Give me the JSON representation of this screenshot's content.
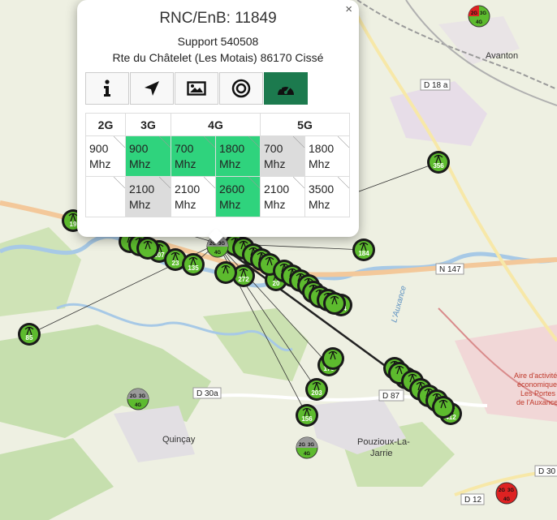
{
  "popup": {
    "title": "RNC/EnB: 11849",
    "support": "Support 540508",
    "address": "Rte du Châtelet (Les Motais) 86170 Cissé",
    "close": "×",
    "tabs": [
      "info-icon",
      "navigate-icon",
      "photo-icon",
      "target-icon",
      "gauge-icon"
    ],
    "active_tab": "gauge-icon",
    "headers": [
      "2G",
      "3G",
      "4G",
      "5G"
    ],
    "rows": [
      [
        "900\nMhz",
        "900\nMhz",
        "700\nMhz",
        "1800\nMhz",
        "700\nMhz",
        "1800\nMhz"
      ],
      [
        "",
        "2100\nMhz",
        "2100\nMhz",
        "2600\nMhz",
        "2100\nMhz",
        "3500\nMhz"
      ]
    ],
    "states": [
      [
        "na",
        "on",
        "on",
        "on",
        "off",
        "na"
      ],
      [
        "na",
        "off",
        "na",
        "on",
        "na",
        "na"
      ]
    ]
  },
  "map": {
    "places": [
      "Avanton",
      "Quinçay",
      "Pouzioux-La-\nJarrie"
    ],
    "roads": [
      "D 18 a",
      "N 147",
      "D 30a",
      "D 87",
      "D 12",
      "D 30"
    ],
    "river": "L'Auxance",
    "poi": [
      "Aire d'activité",
      "économique",
      "Les Portes",
      "de l'Auxance"
    ],
    "markers": [
      "356",
      "184",
      "207",
      "23",
      "135",
      "272",
      "20",
      "514",
      "179",
      "203",
      "156",
      "85",
      "412",
      "44",
      "19"
    ],
    "site_bands": [
      "2G",
      "3G",
      "4G"
    ],
    "colors": {
      "marker_green": "#5dbb2e",
      "marker_dark": "#1a1a1a",
      "active_tab": "#1c7a4e",
      "band_on": "#2fd37d",
      "band_off": "#dcdcdc"
    }
  }
}
